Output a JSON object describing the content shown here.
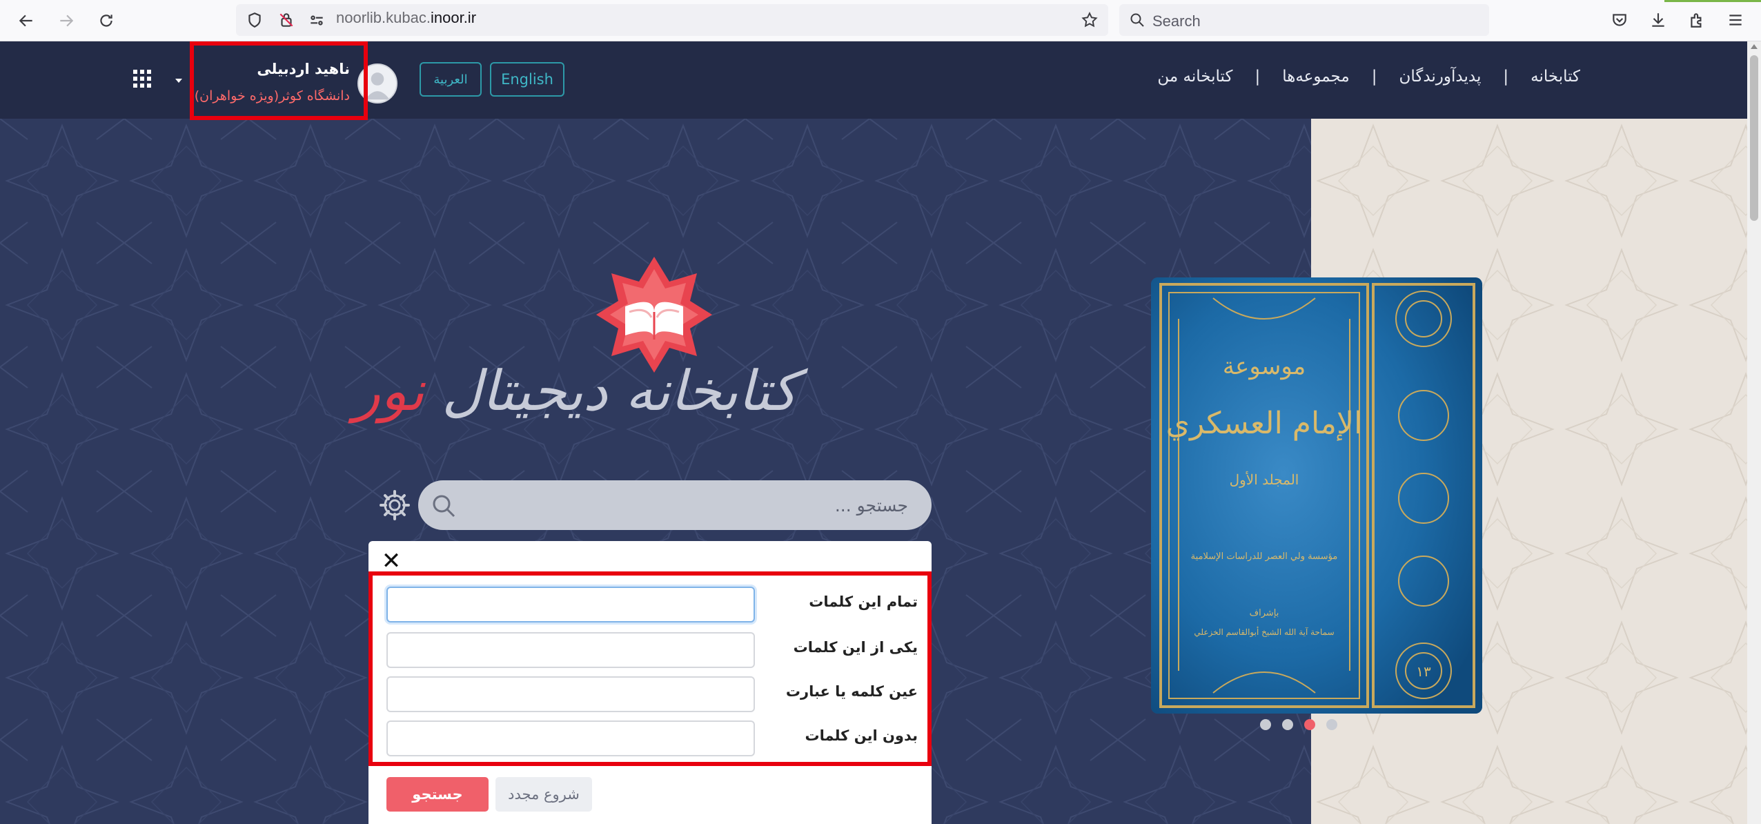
{
  "browser": {
    "url_prefix": "noorlib.kubac.",
    "url_domain": "inoor.ir",
    "search_placeholder": "Search"
  },
  "header": {
    "nav": [
      "کتابخانه",
      "پدیدآورندگان",
      "مجموعه‌ها",
      "کتابخانه من"
    ],
    "lang_english": "English",
    "lang_arabic": "العربية",
    "user_name": "ناهید اردبیلی",
    "user_org": "دانشگاه کوثر(ویژه خواهران)"
  },
  "logo": {
    "title_main": "کتابخانه دیجیتال",
    "title_accent": "نور"
  },
  "search": {
    "placeholder": "جستجو ..."
  },
  "advanced": {
    "close": "✕",
    "rows": [
      {
        "label": "تمام این کلمات",
        "value": ""
      },
      {
        "label": "یکی از این کلمات",
        "value": ""
      },
      {
        "label": "عین کلمه یا عبارت",
        "value": ""
      },
      {
        "label": "بدون این کلمات",
        "value": ""
      }
    ],
    "search_button": "جستجو",
    "reset_button": "شروع مجدد"
  },
  "book": {
    "title_line1": "موسوعة",
    "title_line2": "الإمام العسكري",
    "volume": "المجلد الأول",
    "publisher": "مؤسسة ولي العصر للدراسات الإسلامية",
    "supervisor_1": "بإشراف",
    "supervisor_2": "سماحة آية الله الشيخ أبوالقاسم الخزعلي",
    "number": "١٣"
  },
  "carousel": {
    "slide_count": 4,
    "active_index": 2
  },
  "colors": {
    "header_bg": "#232b47",
    "hero_bg": "#2f3a5e",
    "accent_red": "#f0606a",
    "lang_teal": "#3fb8c7",
    "highlight_box": "#e8000e"
  }
}
